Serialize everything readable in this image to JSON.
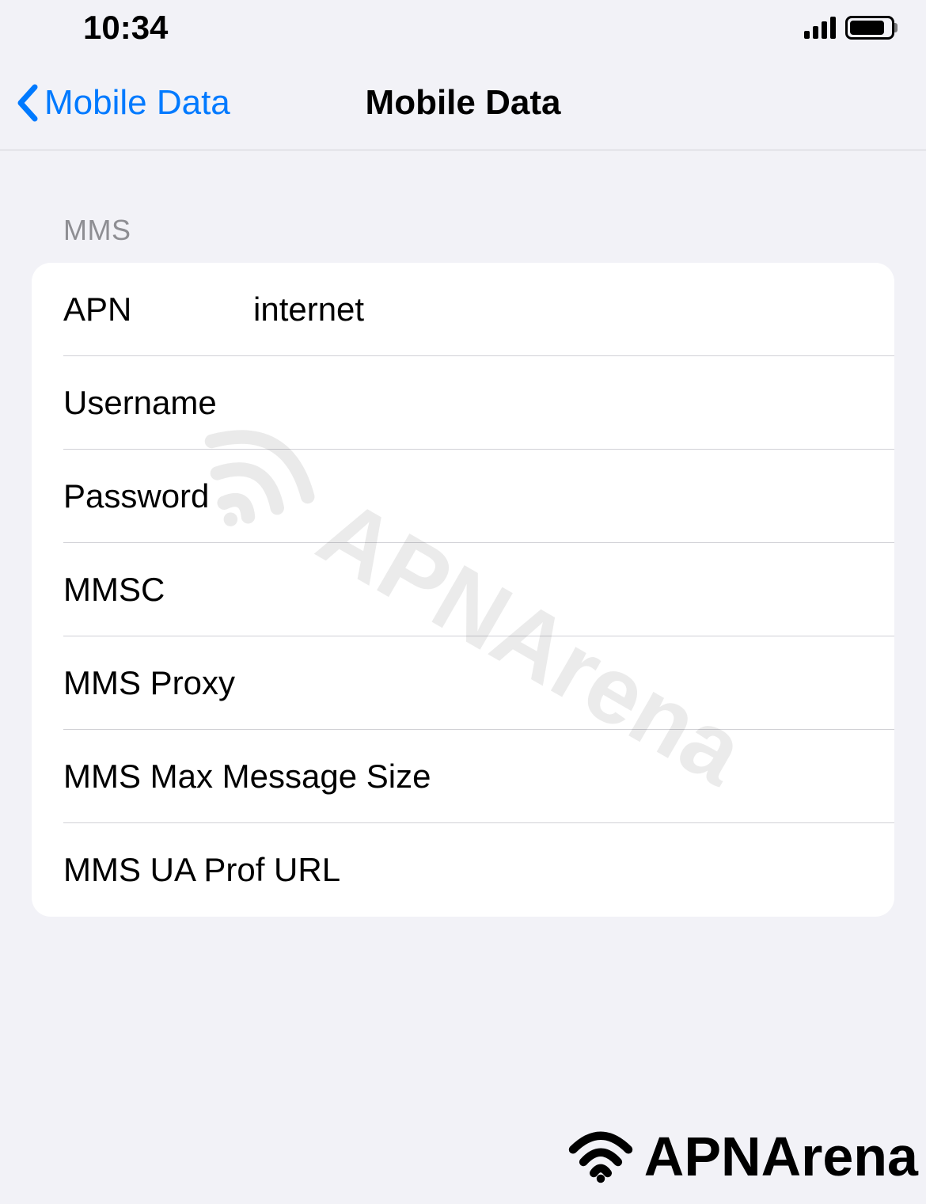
{
  "status_bar": {
    "time": "10:34"
  },
  "nav": {
    "back_label": "Mobile Data",
    "title": "Mobile Data"
  },
  "section": {
    "header": "MMS",
    "rows": [
      {
        "label": "APN",
        "value": "internet"
      },
      {
        "label": "Username",
        "value": ""
      },
      {
        "label": "Password",
        "value": ""
      },
      {
        "label": "MMSC",
        "value": ""
      },
      {
        "label": "MMS Proxy",
        "value": ""
      },
      {
        "label": "MMS Max Message Size",
        "value": ""
      },
      {
        "label": "MMS UA Prof URL",
        "value": ""
      }
    ]
  },
  "watermark": {
    "brand": "APNArena"
  }
}
